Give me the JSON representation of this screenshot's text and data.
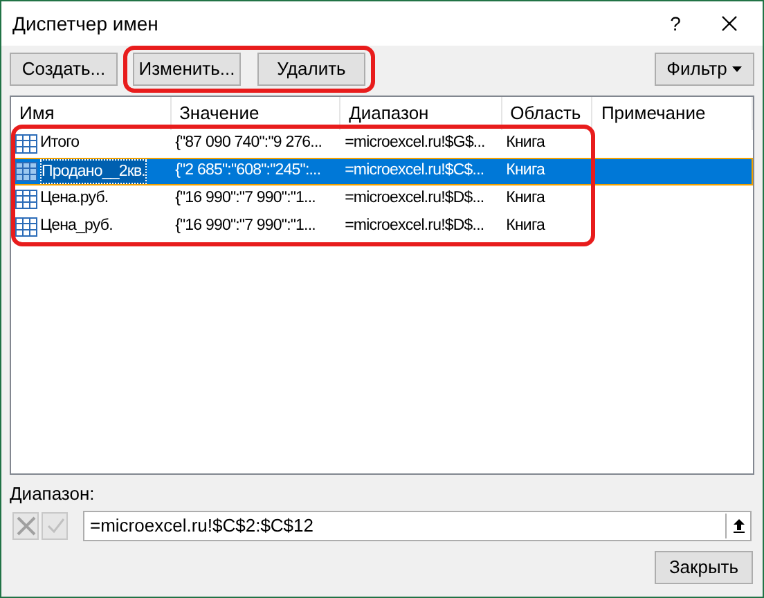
{
  "window": {
    "title": "Диспетчер имен",
    "help": "?"
  },
  "buttons": [
    {
      "label": "Создать...",
      "highlighted": false
    },
    {
      "label": "Изменить...",
      "highlighted": true
    },
    {
      "label": "Удалить",
      "highlighted": true
    }
  ],
  "filter_button": {
    "label": "Фильтр"
  },
  "table": {
    "columns": [
      "Имя",
      "Значение",
      "Диапазон",
      "Область",
      "Примечание"
    ],
    "rows": [
      {
        "cells": [
          "Итого",
          "{\"87 090 740\":\"9 276...",
          "=microexcel.ru!$G$...",
          "Книга",
          ""
        ],
        "selected": false,
        "highlighted": true
      },
      {
        "cells": [
          "Продано__2кв.",
          "{\"2 685\":\"608\":\"245\":...",
          "=microexcel.ru!$C$...",
          "Книга",
          ""
        ],
        "selected": true,
        "highlighted": true
      },
      {
        "cells": [
          "Цена.руб.",
          "{\"16 990\":\"7 990\":\"1...",
          "=microexcel.ru!$D$...",
          "Книга",
          ""
        ],
        "selected": false,
        "highlighted": true
      },
      {
        "cells": [
          "Цена_руб.",
          "{\"16 990\":\"7 990\":\"1...",
          "=microexcel.ru!$D$...",
          "Книга",
          ""
        ],
        "selected": false,
        "highlighted": true
      }
    ]
  },
  "range": {
    "label": "Диапазон:",
    "value": "=microexcel.ru!$C$2:$C$12"
  },
  "close_button": {
    "label": "Закрыть"
  }
}
